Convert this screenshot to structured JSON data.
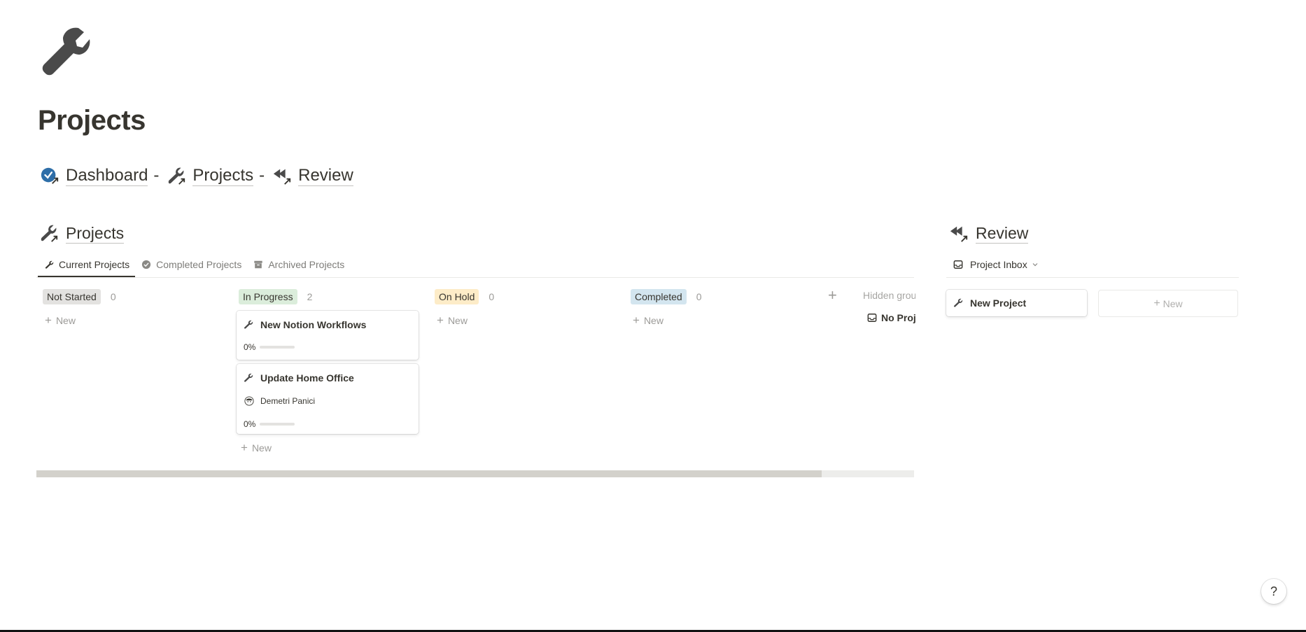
{
  "page": {
    "icon": "wrench-icon",
    "title": "Projects"
  },
  "breadcrumbs": [
    {
      "icon": "check-circle-link-icon",
      "label": "Dashboard",
      "sep": "-"
    },
    {
      "icon": "wrench-link-icon",
      "label": "Projects",
      "sep": "-"
    },
    {
      "icon": "review-arrows-link-icon",
      "label": "Review",
      "sep": ""
    }
  ],
  "projects_section": {
    "title": "Projects",
    "tabs": [
      {
        "label": "Current Projects",
        "icon": "wrench-icon",
        "active": true
      },
      {
        "label": "Completed Projects",
        "icon": "check-circle-icon",
        "active": false
      },
      {
        "label": "Archived Projects",
        "icon": "archive-box-icon",
        "active": false
      }
    ],
    "columns": [
      {
        "label": "Not Started",
        "count": "0",
        "color": "#e3e2e0"
      },
      {
        "label": "In Progress",
        "count": "2",
        "color": "#dbeddb"
      },
      {
        "label": "On Hold",
        "count": "0",
        "color": "#fdecc8"
      },
      {
        "label": "Completed",
        "count": "0",
        "color": "#d3e5ef"
      }
    ],
    "new_label": "New",
    "cards": [
      {
        "title": "New Notion Workflows",
        "progress": "0%",
        "progress_value": 0,
        "person": ""
      },
      {
        "title": "Update Home Office",
        "progress": "0%",
        "progress_value": 0,
        "person": "Demetri Panici"
      }
    ],
    "hidden_groups_label": "Hidden groups",
    "hidden_item": "No Projects",
    "scroll_fraction": 0.895
  },
  "review_section": {
    "title": "Review",
    "view_select": "Project Inbox",
    "cards": [
      {
        "title": "New Project"
      }
    ],
    "new_label": "New"
  },
  "help": "?",
  "colors": {
    "accent": "#2e6ea8",
    "text": "#37352f"
  }
}
